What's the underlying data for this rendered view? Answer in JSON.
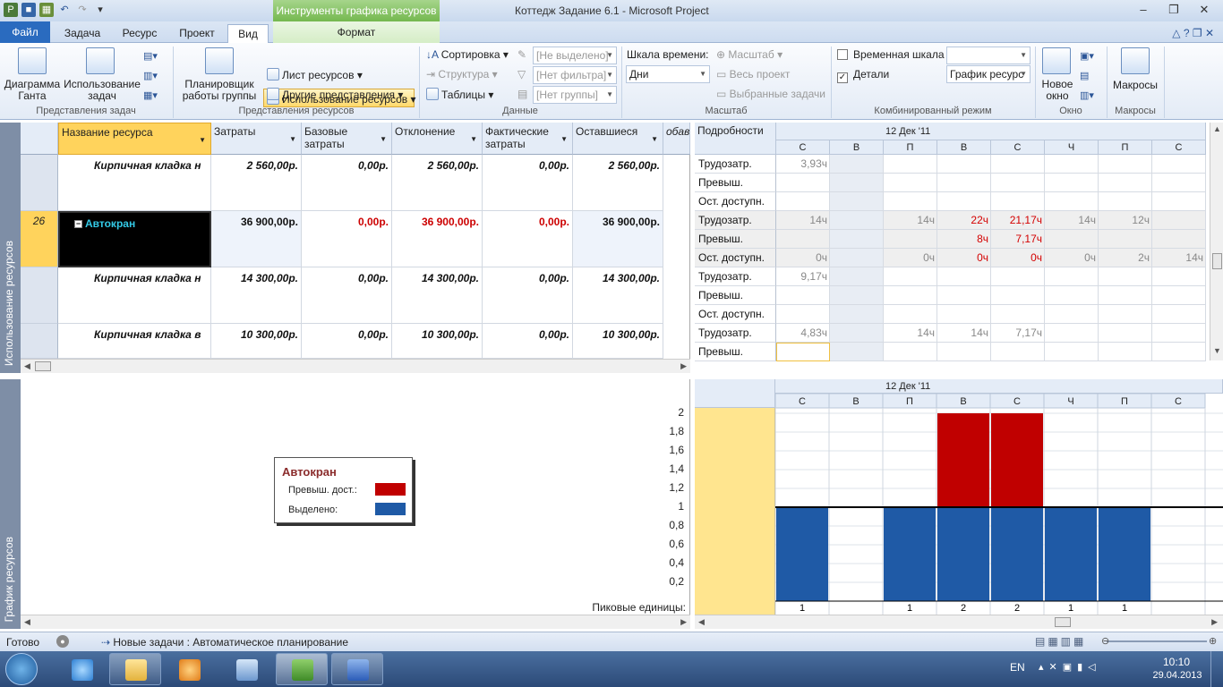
{
  "titlebar": {
    "context_title": "Инструменты графика ресурсов",
    "window_title": "Коттедж Задание 6.1  -  Microsoft Project",
    "min": "–",
    "max": "❐",
    "close": "✕"
  },
  "tabs": {
    "file": "Файл",
    "task": "Задача",
    "resource": "Ресурс",
    "project": "Проект",
    "view": "Вид",
    "format": "Формат",
    "help_icons": "△ ? ❐ ✕"
  },
  "ribbon": {
    "gantt": "Диаграмма\nГанта",
    "task_usage": "Использование\nзадач",
    "team_planner": "Планировщик\nработы группы",
    "resource_usage": "Использование ресурсов",
    "resource_sheet": "Лист ресурсов",
    "other_views": "Другие представления",
    "sort": "Сортировка",
    "outline": "Структура",
    "tables": "Таблицы",
    "highlight": "[Не выделено]",
    "filter": "[Нет фильтра]",
    "group": "[Нет группы]",
    "timescale_label": "Шкала времени:",
    "timescale_value": "Дни",
    "zoom": "Масштаб",
    "entire_project": "Весь проект",
    "selected_tasks": "Выбранные задачи",
    "timeline": "Временная шкала",
    "details": "Детали",
    "details_value": "График ресурс",
    "new_window": "Новое\nокно",
    "macros": "Макросы",
    "groups": {
      "task_views": "Представления задач",
      "resource_views": "Представления ресурсов",
      "data": "Данные",
      "zoom": "Масштаб",
      "split": "Комбинированный режим",
      "window": "Окно",
      "macros": "Макросы"
    }
  },
  "sidebars": {
    "upper": "Использование ресурсов",
    "lower": "График ресурсов"
  },
  "table": {
    "columns": [
      "Название ресурса",
      "Затраты",
      "Базовые затраты",
      "Отклонение",
      "Фактические затраты",
      "Оставшиеся",
      "обави"
    ],
    "rows": [
      {
        "id": "",
        "name": "Кирпичная кладка н",
        "values": [
          "2 560,00р.",
          "0,00р.",
          "2 560,00р.",
          "0,00р.",
          "2 560,00р."
        ]
      },
      {
        "id": "26",
        "name": "Автокран",
        "values": [
          "36 900,00р.",
          "0,00р.",
          "36 900,00р.",
          "0,00р.",
          "36 900,00р."
        ]
      },
      {
        "id": "",
        "name": "Кирпичная кладка н",
        "values": [
          "14 300,00р.",
          "0,00р.",
          "14 300,00р.",
          "0,00р.",
          "14 300,00р."
        ]
      },
      {
        "id": "",
        "name": "Кирпичная кладка в",
        "values": [
          "10 300,00р.",
          "0,00р.",
          "10 300,00р.",
          "0,00р.",
          "10 300,00р."
        ]
      }
    ],
    "collapse_sign": "−"
  },
  "details": {
    "header": "Подробности",
    "week": "12 Дек '11",
    "days": [
      "С",
      "В",
      "П",
      "В",
      "С",
      "Ч",
      "П",
      "С"
    ],
    "rows": [
      {
        "label": "Трудозатр.",
        "cells": [
          "3,93ч",
          "",
          "",
          "",
          "",
          "",
          "",
          ""
        ]
      },
      {
        "label": "Превыш.",
        "cells": [
          "",
          "",
          "",
          "",
          "",
          "",
          "",
          ""
        ]
      },
      {
        "label": "Ост. доступн.",
        "cells": [
          "",
          "",
          "",
          "",
          "",
          "",
          "",
          ""
        ]
      },
      {
        "label": "Трудозатр.",
        "cells": [
          "14ч",
          "",
          "14ч",
          "22ч",
          "21,17ч",
          "14ч",
          "12ч",
          ""
        ]
      },
      {
        "label": "Превыш.",
        "cells": [
          "",
          "",
          "",
          "8ч",
          "7,17ч",
          "",
          "",
          ""
        ]
      },
      {
        "label": "Ост. доступн.",
        "cells": [
          "0ч",
          "",
          "0ч",
          "0ч",
          "0ч",
          "0ч",
          "2ч",
          "14ч"
        ]
      },
      {
        "label": "Трудозатр.",
        "cells": [
          "9,17ч",
          "",
          "",
          "",
          "",
          "",
          "",
          ""
        ]
      },
      {
        "label": "Превыш.",
        "cells": [
          "",
          "",
          "",
          "",
          "",
          "",
          "",
          ""
        ]
      },
      {
        "label": "Ост. доступн.",
        "cells": [
          "",
          "",
          "",
          "",
          "",
          "",
          "",
          ""
        ]
      },
      {
        "label": "Трудозатр.",
        "cells": [
          "4,83ч",
          "",
          "14ч",
          "14ч",
          "7,17ч",
          "",
          "",
          ""
        ]
      },
      {
        "label": "Превыш.",
        "cells": [
          "",
          "",
          "",
          "",
          "",
          "",
          "",
          ""
        ]
      }
    ]
  },
  "legend": {
    "title": "Автокран",
    "over": "Превыш. дост.:",
    "allocated": "Выделено:",
    "over_color": "#c00000",
    "allocated_color": "#1f5aa6"
  },
  "chart_data": {
    "type": "bar",
    "categories": [
      "С",
      "В",
      "П",
      "В",
      "С",
      "Ч",
      "П",
      "С"
    ],
    "series": [
      {
        "name": "Выделено:",
        "values": [
          1,
          0,
          1,
          1,
          1,
          1,
          1,
          0
        ]
      },
      {
        "name": "Превыш. дост.:",
        "values": [
          0,
          0,
          0,
          1,
          1,
          0,
          0,
          0
        ]
      }
    ],
    "peak_label": "Пиковые единицы:",
    "peak_units": [
      "1",
      "",
      "1",
      "2",
      "2",
      "1",
      "1",
      ""
    ],
    "yticks": [
      "2",
      "1,8",
      "1,6",
      "1,4",
      "1,2",
      "1",
      "0,8",
      "0,6",
      "0,4",
      "0,2"
    ],
    "ylim": [
      0,
      2
    ],
    "week": "12 Дек '11"
  },
  "status": {
    "ready": "Готово",
    "mode": "Новые задачи : Автоматическое планирование"
  },
  "taskbar": {
    "lang": "EN",
    "time": "10:10",
    "date": "29.04.2013"
  }
}
